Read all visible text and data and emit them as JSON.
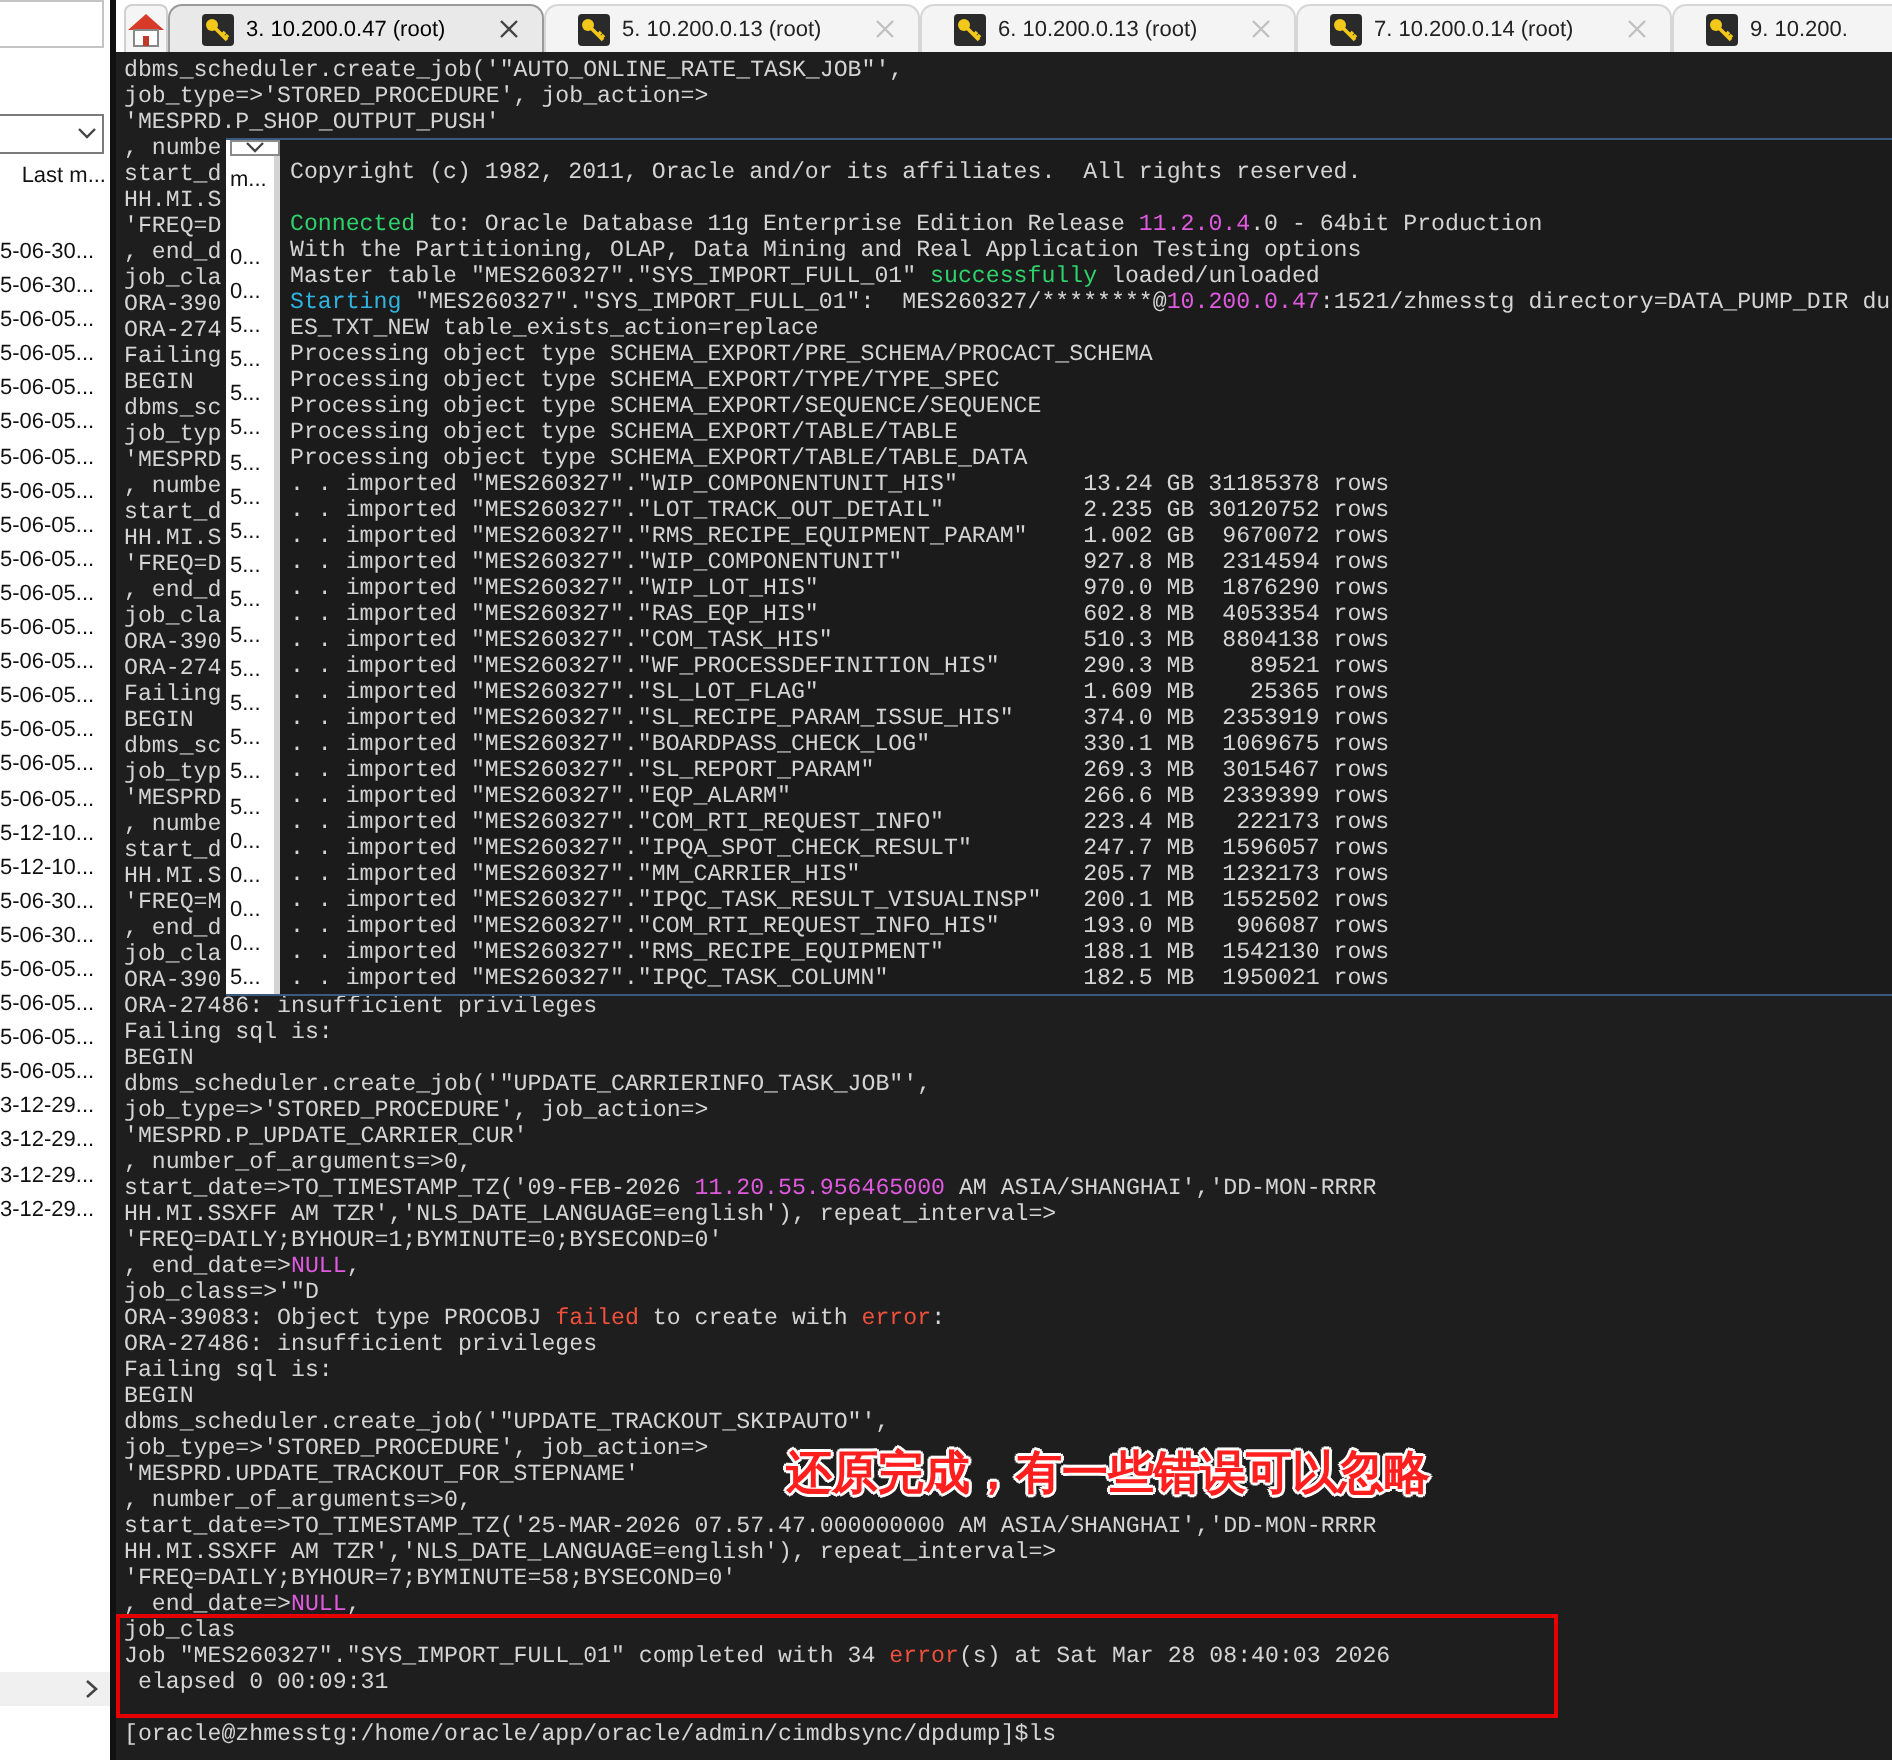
{
  "side_panel": {
    "column_header": "Last m...",
    "rows": [
      "5-06-30...",
      "5-06-30...",
      "5-06-05...",
      "5-06-05...",
      "5-06-05...",
      "5-06-05...",
      "5-06-05...",
      "5-06-05...",
      "5-06-05...",
      "5-06-05...",
      "5-06-05...",
      "5-06-05...",
      "5-06-05...",
      "5-06-05...",
      "5-06-05...",
      "5-06-05...",
      "5-06-05...",
      "5-12-10...",
      "5-12-10...",
      "5-06-30...",
      "5-06-30...",
      "5-06-05...",
      "5-06-05...",
      "5-06-05...",
      "5-06-05...",
      "3-12-29...",
      "3-12-29...",
      "3-12-29...",
      "3-12-29..."
    ]
  },
  "tabs": [
    {
      "label": "3. 10.200.0.47 (root)",
      "selected": true
    },
    {
      "label": "5. 10.200.0.13 (root)",
      "selected": false
    },
    {
      "label": "6. 10.200.0.13 (root)",
      "selected": false
    },
    {
      "label": "7. 10.200.0.14 (root)",
      "selected": false
    },
    {
      "label": "9. 10.200.",
      "selected": false
    }
  ],
  "terminal": {
    "blocks": [
      [
        "dbms_scheduler.create_job('\"AUTO_ONLINE_RATE_TASK_JOB\"',",
        "job_type=>'STORED_PROCEDURE', job_action=>",
        "'MESPRD.P_SHOP_OUTPUT_PUSH'",
        ", numbe",
        "start_d",
        "HH.MI.S",
        "'FREQ=D",
        ", end_d",
        "job_cla",
        "ORA-390",
        "ORA-274",
        "Failing",
        "BEGIN",
        "dbms_sc",
        "job_typ",
        "'MESPRD",
        ", numbe",
        "start_d",
        "HH.MI.S",
        "'FREQ=D",
        ", end_d",
        "job_cla",
        "ORA-390",
        "ORA-274",
        "Failing",
        "BEGIN",
        "dbms_sc",
        "job_typ",
        "'MESPRD",
        ", numbe",
        "start_d",
        "HH.MI.S",
        "'FREQ=M",
        ", end_d",
        "job_cla",
        "ORA-390",
        "ORA-27486: insufficient privileges",
        "Failing sql is:",
        "BEGIN",
        "dbms_scheduler.create_job('\"UPDATE_CARRIERINFO_TASK_JOB\"',",
        "job_type=>'STORED_PROCEDURE', job_action=>",
        "'MESPRD.P_UPDATE_CARRIER_CUR'",
        ", number_of_arguments=>0,",
        [
          "start_date=>TO_TIMESTAMP_TZ('09-FEB-2026 ",
          {
            "text": "11.20.55.956465000",
            "kind": "number"
          },
          " AM ASIA/SHANGHAI','DD-MON-RRRR"
        ],
        "HH.MI.SSXFF AM TZR','NLS_DATE_LANGUAGE=english'), repeat_interval=>",
        "'FREQ=DAILY;BYHOUR=1;BYMINUTE=0;BYSECOND=0'",
        [
          ", end_date=>",
          {
            "text": "NULL",
            "kind": "number"
          },
          ","
        ],
        "job_class=>'\"D",
        [
          "ORA-39083: Object type PROCOBJ ",
          {
            "text": "failed",
            "kind": "error"
          },
          " to create with ",
          {
            "text": "error",
            "kind": "error"
          },
          ":"
        ],
        "ORA-27486: insufficient privileges",
        "Failing sql is:",
        "BEGIN",
        "dbms_scheduler.create_job('\"UPDATE_TRACKOUT_SKIPAUTO\"',",
        "job_type=>'STORED_PROCEDURE', job_action=>",
        "'MESPRD.UPDATE_TRACKOUT_FOR_STEPNAME'",
        ", number_of_arguments=>0,",
        "start_date=>TO_TIMESTAMP_TZ('25-MAR-2026 07.57.47.000000000 AM ASIA/SHANGHAI','DD-MON-RRRR",
        "HH.MI.SSXFF AM TZR','NLS_DATE_LANGUAGE=english'), repeat_interval=>",
        "'FREQ=DAILY;BYHOUR=7;BYMINUTE=58;BYSECOND=0'",
        [
          ", end_date=>",
          {
            "text": "NULL",
            "kind": "number"
          },
          ","
        ],
        "job_clas",
        [
          "Job \"MES260327\".\"SYS_IMPORT_FULL_01\" completed with 34 ",
          {
            "text": "error",
            "kind": "error"
          },
          "(s) at Sat Mar 28 08:40:03 2026"
        ],
        " elapsed 0 00:09:31"
      ],
      [
        "[oracle@zhmesstg:/home/oracle/app/oracle/admin/cimdbsync/dpdump]$ls"
      ]
    ]
  },
  "dialog": {
    "strip": {
      "column_header": "m...",
      "rows": [
        "0...",
        "0...",
        "5...",
        "5...",
        "5...",
        "5...",
        "5...",
        "5...",
        "5...",
        "5...",
        "5...",
        "5...",
        "5...",
        "5...",
        "5...",
        "5...",
        "5...",
        "0...",
        "0...",
        "0...",
        "0...",
        "5..."
      ]
    },
    "blocks": [
      [
        "Copyright (c) 1982, 2011, Oracle and/or its affiliates.  All rights reserved."
      ],
      [
        [
          {
            "text": "Connected",
            "kind": "success"
          },
          " to: Oracle Database 11g Enterprise Edition Release ",
          {
            "text": "11.2.0.4",
            "kind": "number"
          },
          ".0 - 64bit Production"
        ],
        "With the Partitioning, OLAP, Data Mining and Real Application Testing options",
        [
          "Master table \"MES260327\".\"SYS_IMPORT_FULL_01\" ",
          {
            "text": "successfully",
            "kind": "success"
          },
          " loaded/unloaded"
        ],
        [
          {
            "text": "Starting",
            "kind": "info"
          },
          " \"MES260327\".\"SYS_IMPORT_FULL_01\":  MES260327/********@",
          {
            "text": "10.200.0.47",
            "kind": "number"
          },
          ":1521/zhmesstg directory=DATA_PUMP_DIR du"
        ],
        "ES_TXT_NEW table_exists_action=replace",
        "Processing object type SCHEMA_EXPORT/PRE_SCHEMA/PROCACT_SCHEMA",
        "Processing object type SCHEMA_EXPORT/TYPE/TYPE_SPEC",
        "Processing object type SCHEMA_EXPORT/SEQUENCE/SEQUENCE",
        "Processing object type SCHEMA_EXPORT/TABLE/TABLE",
        "Processing object type SCHEMA_EXPORT/TABLE/TABLE_DATA"
      ]
    ],
    "imports": [
      {
        "table": ". . imported \"MES260327\".\"WIP_COMPONENTUNIT_HIS\"",
        "size": "13.24 GB",
        "rows": "31185378 rows"
      },
      {
        "table": ". . imported \"MES260327\".\"LOT_TRACK_OUT_DETAIL\"",
        "size": "2.235 GB",
        "rows": "30120752 rows"
      },
      {
        "table": ". . imported \"MES260327\".\"RMS_RECIPE_EQUIPMENT_PARAM\"",
        "size": "1.002 GB",
        "rows": "9670072 rows"
      },
      {
        "table": ". . imported \"MES260327\".\"WIP_COMPONENTUNIT\"",
        "size": "927.8 MB",
        "rows": "2314594 rows"
      },
      {
        "table": ". . imported \"MES260327\".\"WIP_LOT_HIS\"",
        "size": "970.0 MB",
        "rows": "1876290 rows"
      },
      {
        "table": ". . imported \"MES260327\".\"RAS_EQP_HIS\"",
        "size": "602.8 MB",
        "rows": "4053354 rows"
      },
      {
        "table": ". . imported \"MES260327\".\"COM_TASK_HIS\"",
        "size": "510.3 MB",
        "rows": "8804138 rows"
      },
      {
        "table": ". . imported \"MES260327\".\"WF_PROCESSDEFINITION_HIS\"",
        "size": "290.3 MB",
        "rows": "89521 rows"
      },
      {
        "table": ". . imported \"MES260327\".\"SL_LOT_FLAG\"",
        "size": "1.609 MB",
        "rows": "25365 rows"
      },
      {
        "table": ". . imported \"MES260327\".\"SL_RECIPE_PARAM_ISSUE_HIS\"",
        "size": "374.0 MB",
        "rows": "2353919 rows"
      },
      {
        "table": ". . imported \"MES260327\".\"BOARDPASS_CHECK_LOG\"",
        "size": "330.1 MB",
        "rows": "1069675 rows"
      },
      {
        "table": ". . imported \"MES260327\".\"SL_REPORT_PARAM\"",
        "size": "269.3 MB",
        "rows": "3015467 rows"
      },
      {
        "table": ". . imported \"MES260327\".\"EQP_ALARM\"",
        "size": "266.6 MB",
        "rows": "2339399 rows"
      },
      {
        "table": ". . imported \"MES260327\".\"COM_RTI_REQUEST_INFO\"",
        "size": "223.4 MB",
        "rows": "222173 rows"
      },
      {
        "table": ". . imported \"MES260327\".\"IPQA_SPOT_CHECK_RESULT\"",
        "size": "247.7 MB",
        "rows": "1596057 rows"
      },
      {
        "table": ". . imported \"MES260327\".\"MM_CARRIER_HIS\"",
        "size": "205.7 MB",
        "rows": "1232173 rows"
      },
      {
        "table": ". . imported \"MES260327\".\"IPQC_TASK_RESULT_VISUALINSP\"",
        "size": "200.1 MB",
        "rows": "1552502 rows"
      },
      {
        "table": ". . imported \"MES260327\".\"COM_RTI_REQUEST_INFO_HIS\"",
        "size": "193.0 MB",
        "rows": "906087 rows"
      },
      {
        "table": ". . imported \"MES260327\".\"RMS_RECIPE_EQUIPMENT\"",
        "size": "188.1 MB",
        "rows": "1542130 rows"
      },
      {
        "table": ". . imported \"MES260327\".\"IPQC_TASK_COLUMN\"",
        "size": "182.5 MB",
        "rows": "1950021 rows"
      }
    ]
  },
  "annotation": {
    "text": "还原完成，有一些错误可以忽略"
  }
}
